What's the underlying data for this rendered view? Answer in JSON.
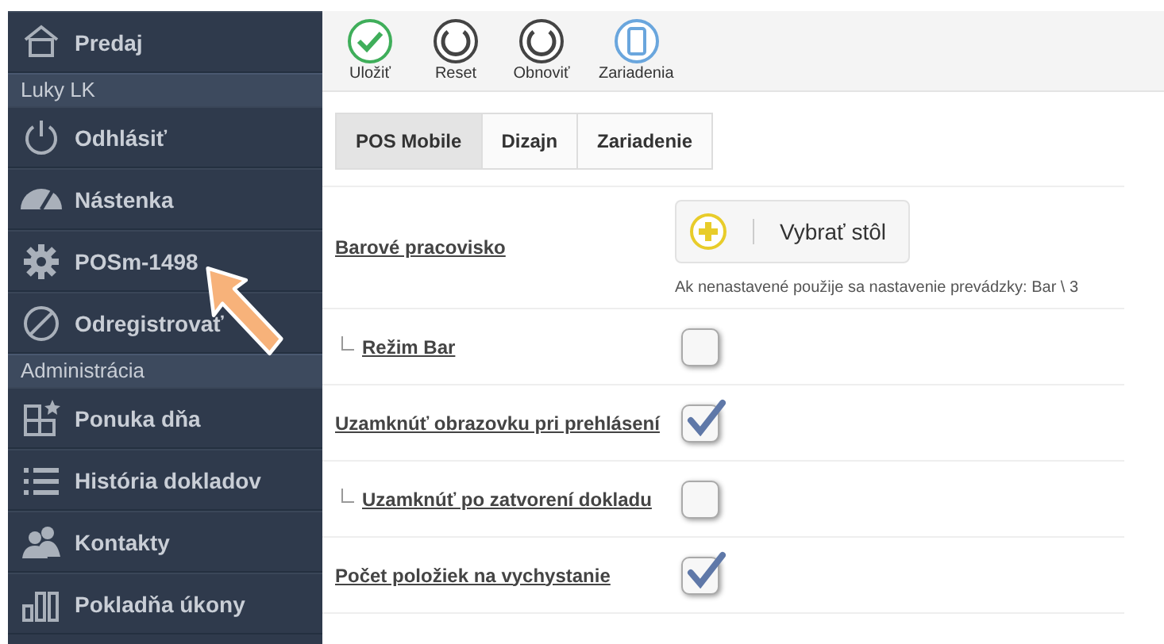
{
  "sidebar": {
    "items": [
      {
        "kind": "item",
        "label": "Predaj"
      },
      {
        "kind": "section",
        "label": "Luky LK"
      },
      {
        "kind": "item",
        "label": "Odhlásiť"
      },
      {
        "kind": "item",
        "label": "Nástenka"
      },
      {
        "kind": "item",
        "label": "POSm-1498"
      },
      {
        "kind": "item",
        "label": "Odregistrovať"
      },
      {
        "kind": "section",
        "label": "Administrácia"
      },
      {
        "kind": "item",
        "label": "Ponuka dňa"
      },
      {
        "kind": "item",
        "label": "História dokladov"
      },
      {
        "kind": "item",
        "label": "Kontakty"
      },
      {
        "kind": "item",
        "label": "Pokladňa úkony"
      }
    ]
  },
  "toolbar": {
    "buttons": [
      {
        "label": "Uložiť"
      },
      {
        "label": "Reset"
      },
      {
        "label": "Obnoviť"
      },
      {
        "label": "Zariadenia"
      }
    ]
  },
  "tabs": [
    {
      "label": "POS Mobile",
      "selected": true
    },
    {
      "label": "Dizajn",
      "selected": false
    },
    {
      "label": "Zariadenie",
      "selected": false
    }
  ],
  "settings": [
    {
      "kind": "picker",
      "label": "Barové pracovisko",
      "button": "Vybrať stôl",
      "hint": "Ak nenastavené použije sa nastavenie prevádzky: Bar \\ 3",
      "children": [
        {
          "kind": "checkbox",
          "label": "Režim Bar",
          "checked": false
        }
      ]
    },
    {
      "kind": "checkbox",
      "label": "Uzamknúť obrazovku pri prehlásení",
      "checked": true,
      "children": [
        {
          "kind": "checkbox",
          "label": "Uzamknúť po zatvorení dokladu",
          "checked": false
        }
      ]
    },
    {
      "kind": "checkbox",
      "label": "Počet položiek na vychystanie",
      "checked": true
    }
  ]
}
